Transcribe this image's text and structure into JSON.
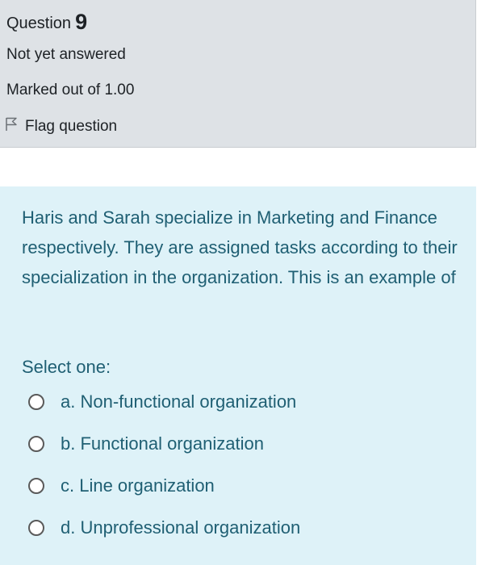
{
  "question_info": {
    "label": "Question",
    "number": "9",
    "state": "Not yet answered",
    "grade": "Marked out of 1.00",
    "flag_label": "Flag question",
    "flag_icon": "flag-outline-icon"
  },
  "question": {
    "text": "Haris and Sarah specialize in Marketing and Finance respectively. They are assigned tasks according to their specialization in the organization. This is an example of",
    "prompt": "Select one:",
    "options": [
      {
        "label": "a. Non-functional organization",
        "selected": false
      },
      {
        "label": "b. Functional organization",
        "selected": false
      },
      {
        "label": "c. Line organization",
        "selected": false
      },
      {
        "label": "d. Unprofessional organization",
        "selected": false
      }
    ]
  },
  "colors": {
    "info_background": "#dee2e6",
    "content_background": "#def2f8",
    "question_text": "#1f5f73",
    "info_text": "#1d2125"
  }
}
